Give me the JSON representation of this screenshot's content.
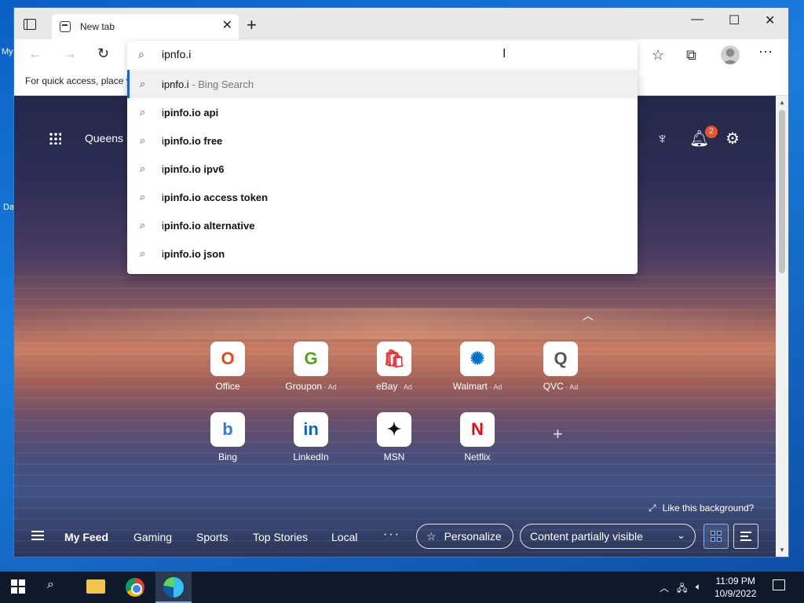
{
  "desktop": {
    "label_my": "My",
    "label_da": "Da"
  },
  "browser": {
    "tab_title": "New tab",
    "tab_close": "✕",
    "new_tab": "+",
    "window_controls": {
      "minimize": "—",
      "maximize": "☐",
      "close": "✕"
    },
    "nav": {
      "back": "←",
      "forward": "→",
      "refresh": "↻"
    },
    "address_bar": {
      "value": "ipnfo.i"
    },
    "favorites_bar_text": "For quick access, place y"
  },
  "suggestions": [
    {
      "typed": "ipnfo.i",
      "rest": "",
      "hint": " - Bing Search",
      "selected": true
    },
    {
      "typed": "i",
      "rest": "pinfo.io api",
      "hint": "",
      "selected": false
    },
    {
      "typed": "i",
      "rest": "pinfo.io free",
      "hint": "",
      "selected": false
    },
    {
      "typed": "i",
      "rest": "pinfo.io ipv6",
      "hint": "",
      "selected": false
    },
    {
      "typed": "i",
      "rest": "pinfo.io access token",
      "hint": "",
      "selected": false
    },
    {
      "typed": "i",
      "rest": "pinfo.io alternative",
      "hint": "",
      "selected": false
    },
    {
      "typed": "i",
      "rest": "pinfo.io json",
      "hint": "",
      "selected": false
    }
  ],
  "newtab": {
    "location": "Queens",
    "notification_count": "2",
    "quick_links": [
      {
        "label": "Office",
        "ad": "",
        "glyph": "O",
        "color": "#e64a19"
      },
      {
        "label": "Groupon",
        "ad": " · Ad",
        "glyph": "G",
        "color": "#53a318"
      },
      {
        "label": "eBay",
        "ad": " · Ad",
        "glyph": "🛍",
        "color": "#e53238"
      },
      {
        "label": "Walmart",
        "ad": " · Ad",
        "glyph": "✺",
        "color": "#0071ce"
      },
      {
        "label": "QVC",
        "ad": " · Ad",
        "glyph": "Q",
        "color": "#555555"
      },
      {
        "label": "Bing",
        "ad": "",
        "glyph": "b",
        "color": "#2b7de9"
      },
      {
        "label": "LinkedIn",
        "ad": "",
        "glyph": "in",
        "color": "#0a66c2"
      },
      {
        "label": "MSN",
        "ad": "",
        "glyph": "✦",
        "color": "#111111"
      },
      {
        "label": "Netflix",
        "ad": "",
        "glyph": "N",
        "color": "#e50914"
      }
    ],
    "add_link": "+",
    "like_background": "Like this background?",
    "feed_tabs": [
      "My Feed",
      "Gaming",
      "Sports",
      "Top Stories",
      "Local"
    ],
    "feed_more": "···",
    "personalize": "Personalize",
    "content_visibility": "Content partially visible"
  },
  "taskbar": {
    "time": "11:09 PM",
    "date": "10/9/2022"
  }
}
